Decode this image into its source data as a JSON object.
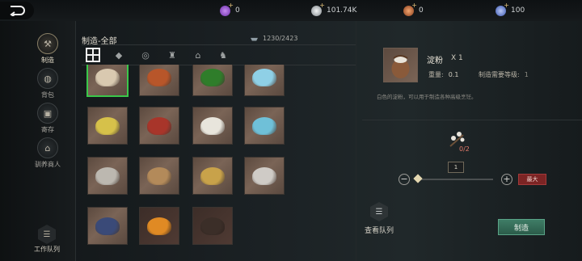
{
  "topbar": {
    "currencies": [
      {
        "icon": "purple-gem-icon",
        "value": "0",
        "color": "#9b5ad6"
      },
      {
        "icon": "silver-coin-icon",
        "value": "101.74K",
        "color": "#c8cdd0"
      },
      {
        "icon": "copper-coin-icon",
        "value": "0",
        "color": "#c8703e"
      },
      {
        "icon": "blue-gem-icon",
        "value": "100",
        "color": "#6e8fe0"
      }
    ]
  },
  "sidebar": {
    "items": [
      {
        "label": "制造",
        "icon": "hammer-icon",
        "active": true
      },
      {
        "label": "背包",
        "icon": "bag-icon",
        "active": false
      },
      {
        "label": "寄存",
        "icon": "storage-icon",
        "active": false
      },
      {
        "label": "驯养商人",
        "icon": "merchant-icon",
        "active": false
      }
    ],
    "queue_label": "工作队列"
  },
  "main": {
    "title": "制造-全部",
    "capacity": "1230/2423",
    "tabs": [
      "all-grid-icon",
      "ore-icon",
      "rope-icon",
      "potion-icon",
      "building-icon",
      "anvil-icon"
    ],
    "items": [
      {
        "name": "flour-sack",
        "color": "#d9c9b0",
        "selected": true
      },
      {
        "name": "red-ore",
        "color": "#b8562a"
      },
      {
        "name": "green-herbs",
        "color": "#2f7d2a"
      },
      {
        "name": "ice-crystal",
        "color": "#8fd0e6"
      },
      {
        "name": "yellow-powder",
        "color": "#d6c14a"
      },
      {
        "name": "red-powder",
        "color": "#a8352a"
      },
      {
        "name": "white-powder",
        "color": "#e8e5dc"
      },
      {
        "name": "blue-powder",
        "color": "#6fc0d8"
      },
      {
        "name": "gray-powder",
        "color": "#bcb8b0"
      },
      {
        "name": "mixed-seeds",
        "color": "#b38a5a"
      },
      {
        "name": "gold-ring",
        "color": "#c8a24a"
      },
      {
        "name": "silver-powder",
        "color": "#cfcbc6"
      },
      {
        "name": "blue-berries",
        "color": "#3a4a78"
      },
      {
        "name": "amber-gem",
        "color": "#e08a24"
      },
      {
        "name": "black-seeds",
        "color": "#3b2e28"
      }
    ]
  },
  "detail": {
    "name": "淀粉",
    "qty": "X 1",
    "weight_label": "重量:",
    "weight_value": "0.1",
    "level_label": "制造需要等级:",
    "level_value": "1",
    "description": "白色的淀粉，可以用于制造各种高级烹饪。",
    "material_count": "0/2",
    "quantity": "1",
    "max_label": "最大",
    "view_queue_label": "查看队列",
    "craft_label": "制造"
  }
}
